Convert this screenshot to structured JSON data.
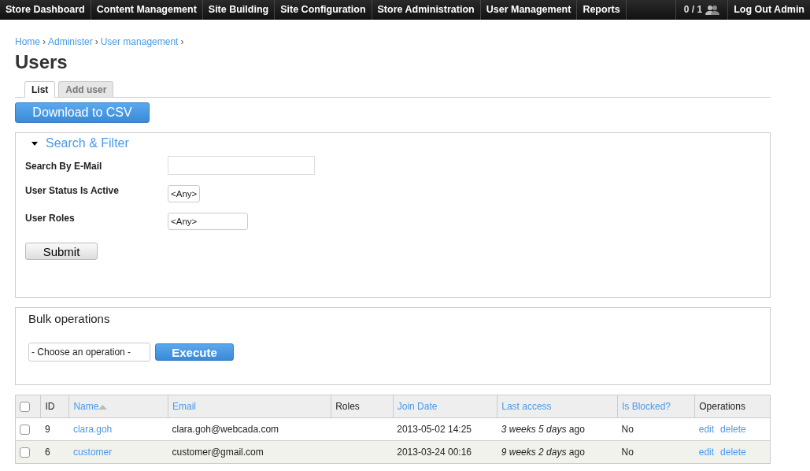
{
  "top_bar": {
    "menu": [
      {
        "label": "Store Dashboard"
      },
      {
        "label": "Content Management"
      },
      {
        "label": "Site Building"
      },
      {
        "label": "Site Configuration"
      },
      {
        "label": "Store Administration"
      },
      {
        "label": "User Management"
      },
      {
        "label": "Reports"
      }
    ],
    "online_count": "0 / 1",
    "logout": "Log Out Admin"
  },
  "breadcrumb": [
    {
      "label": "Home",
      "separator": "›"
    },
    {
      "label": "Administer",
      "separator": "›"
    },
    {
      "label": "User management",
      "separator": "›"
    }
  ],
  "page_title": "Users",
  "tabs": [
    {
      "label": "List",
      "selected": true
    },
    {
      "label": "Add user",
      "selected": false
    }
  ],
  "download_button": "Download to CSV",
  "filter": {
    "title": "Search & Filter",
    "expanded": true,
    "fields": [
      {
        "label": "Search By E-Mail",
        "kind": "text"
      },
      {
        "label": "User Status Is Active",
        "kind": "select",
        "value": "<Any>"
      },
      {
        "label": "User Roles",
        "kind": "select",
        "value": "<Any>"
      }
    ],
    "submit": "Submit"
  },
  "bulk": {
    "title": "Bulk operations",
    "select": "- Choose an operation -",
    "execute": "Execute"
  },
  "table": {
    "select_all_checked": false,
    "columns": [
      {
        "label": "ID",
        "kind": "plain",
        "sorted": false
      },
      {
        "label": "Name",
        "kind": "sortable",
        "sorted": true
      },
      {
        "label": "Email",
        "kind": "sortable",
        "sorted": false
      },
      {
        "label": "Roles",
        "kind": "plain",
        "sorted": false
      },
      {
        "label": "Join Date",
        "kind": "sortable",
        "sorted": false
      },
      {
        "label": "Last access",
        "kind": "sortable",
        "sorted": false
      },
      {
        "label": "Is Blocked?",
        "kind": "sortable",
        "sorted": false
      },
      {
        "label": "Operations",
        "kind": "plain",
        "sorted": false
      }
    ],
    "rows": [
      {
        "checked": false,
        "id": "9",
        "name": "clara.goh",
        "email": "clara.goh@webcada.com",
        "join_date": "2013-05-02 14:25",
        "last_access": "*3 weeks 5 days* ago",
        "blocked": "No",
        "operations": [
          "edit",
          "delete"
        ]
      },
      {
        "checked": false,
        "id": "6",
        "name": "customer",
        "email": "customer@gmail.com",
        "join_date": "2013-03-24 00:16",
        "last_access": "*9 weeks 2 days* ago",
        "blocked": "No",
        "operations": [
          "edit",
          "delete"
        ]
      }
    ]
  }
}
